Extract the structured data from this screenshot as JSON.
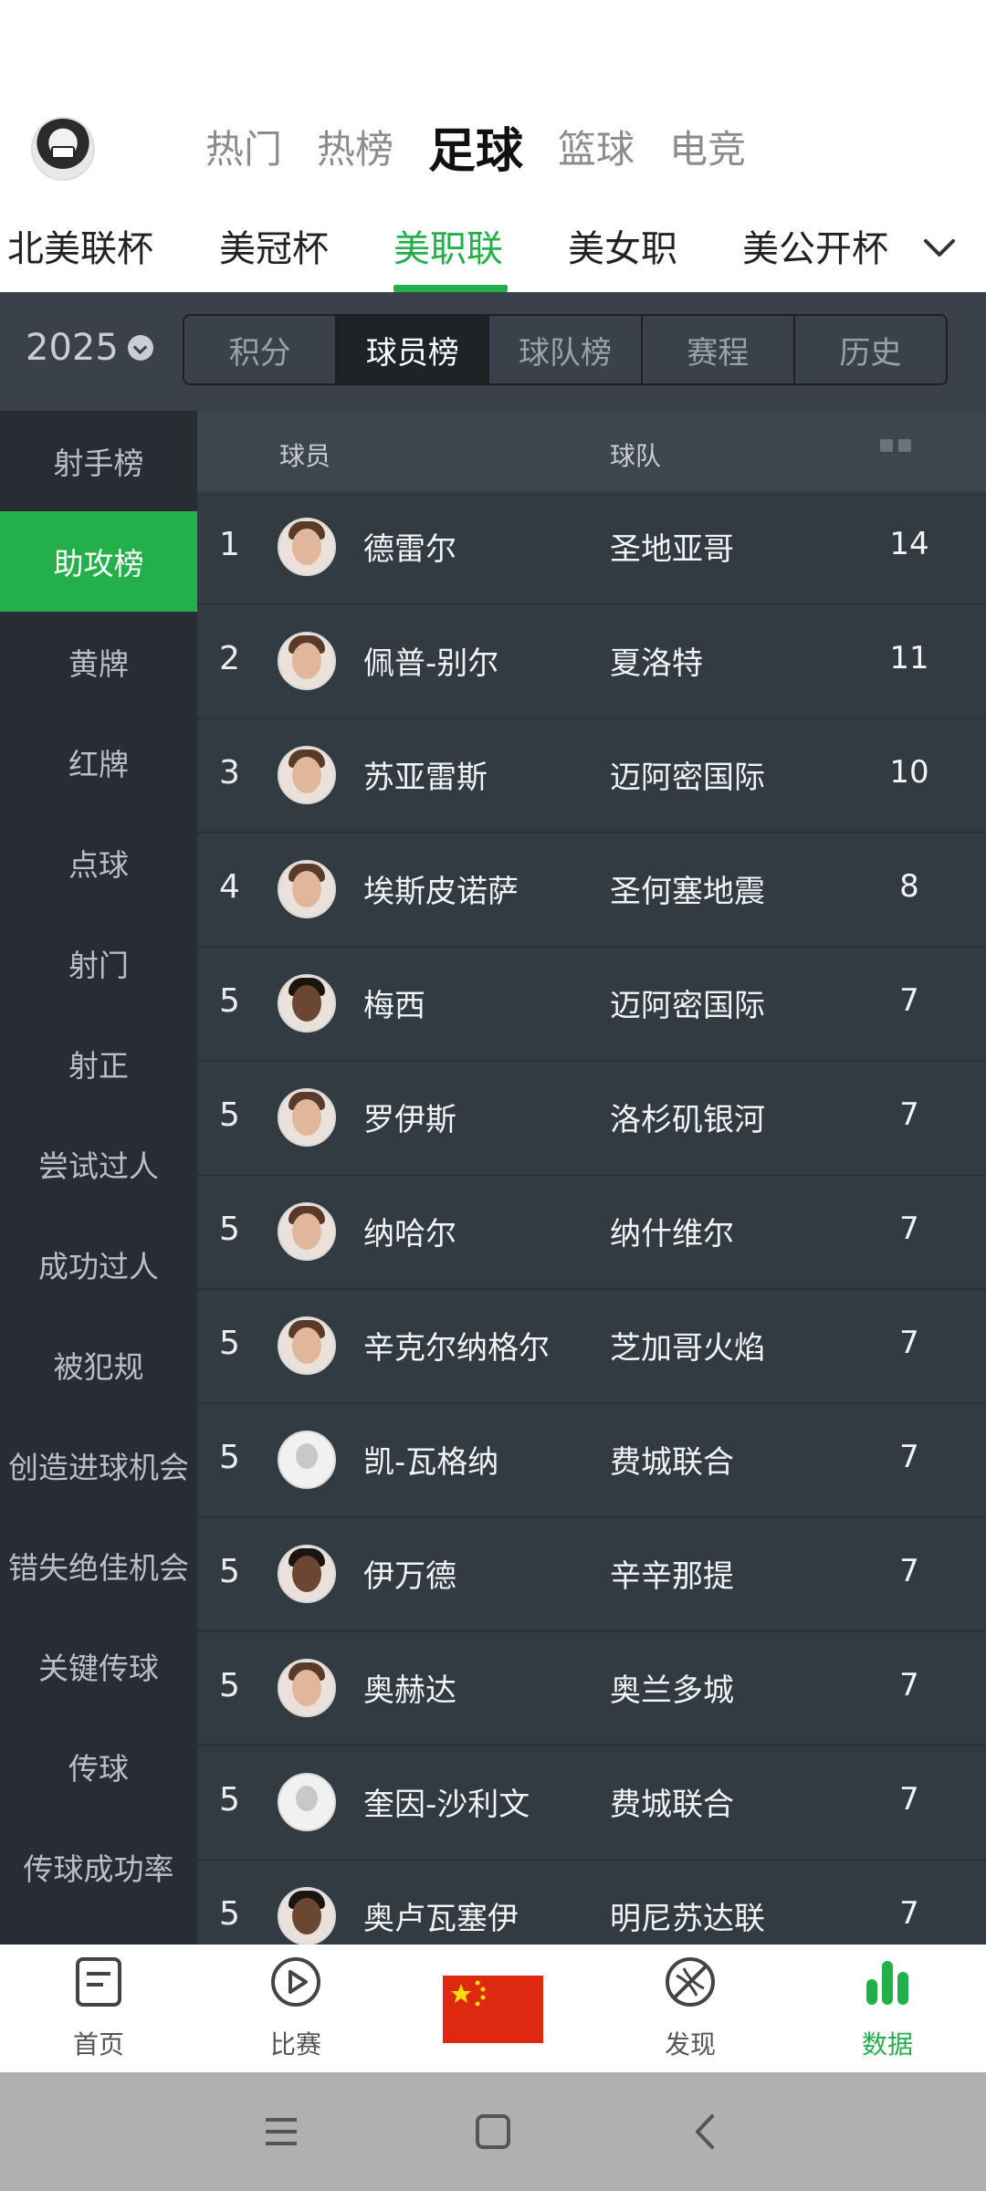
{
  "sport_tabs": [
    "热门",
    "热榜",
    "足球",
    "篮球",
    "电竞"
  ],
  "league_tabs": [
    "北美联杯",
    "美冠杯",
    "美职联",
    "美女职",
    "美公开杯"
  ],
  "active_league": "美职联",
  "season": "2025",
  "stat_tabs": [
    "积分",
    "球员榜",
    "球队榜",
    "赛程",
    "历史"
  ],
  "active_stat_tab": "球员榜",
  "sidebar_items": [
    "射手榜",
    "助攻榜",
    "黄牌",
    "红牌",
    "点球",
    "射门",
    "射正",
    "尝试过人",
    "成功过人",
    "被犯规",
    "创造进球机会",
    "错失绝佳机会",
    "关键传球",
    "传球",
    "传球成功率"
  ],
  "active_sidebar_item": "助攻榜",
  "table_headers": {
    "player": "球员",
    "team": "球队"
  },
  "rows": [
    {
      "rank": "1",
      "name": "德雷尔",
      "team": "圣地亚哥",
      "value": "14"
    },
    {
      "rank": "2",
      "name": "佩普-别尔",
      "team": "夏洛特",
      "value": "11"
    },
    {
      "rank": "3",
      "name": "苏亚雷斯",
      "team": "迈阿密国际",
      "value": "10"
    },
    {
      "rank": "4",
      "name": "埃斯皮诺萨",
      "team": "圣何塞地震",
      "value": "8"
    },
    {
      "rank": "5",
      "name": "梅西",
      "team": "迈阿密国际",
      "value": "7"
    },
    {
      "rank": "5",
      "name": "罗伊斯",
      "team": "洛杉矶银河",
      "value": "7"
    },
    {
      "rank": "5",
      "name": "纳哈尔",
      "team": "纳什维尔",
      "value": "7"
    },
    {
      "rank": "5",
      "name": "辛克尔纳格尔",
      "team": "芝加哥火焰",
      "value": "7"
    },
    {
      "rank": "5",
      "name": "凯-瓦格纳",
      "team": "费城联合",
      "value": "7"
    },
    {
      "rank": "5",
      "name": "伊万德",
      "team": "辛辛那提",
      "value": "7"
    },
    {
      "rank": "5",
      "name": "奥赫达",
      "team": "奥兰多城",
      "value": "7"
    },
    {
      "rank": "5",
      "name": "奎因-沙利文",
      "team": "费城联合",
      "value": "7"
    },
    {
      "rank": "5",
      "name": "奥卢瓦塞伊",
      "team": "明尼苏达联",
      "value": "7"
    }
  ],
  "bottom_nav": [
    {
      "label": "首页",
      "icon": "home-doc-icon"
    },
    {
      "label": "比赛",
      "icon": "play-icon"
    },
    {
      "label": "",
      "icon": "china-flag-icon"
    },
    {
      "label": "发现",
      "icon": "discover-ball-icon"
    },
    {
      "label": "数据",
      "icon": "bar-chart-icon"
    }
  ],
  "colors": {
    "accent": "#23b04a",
    "dark_bg": "#2e353d",
    "sidebar_bg": "#272d33"
  }
}
